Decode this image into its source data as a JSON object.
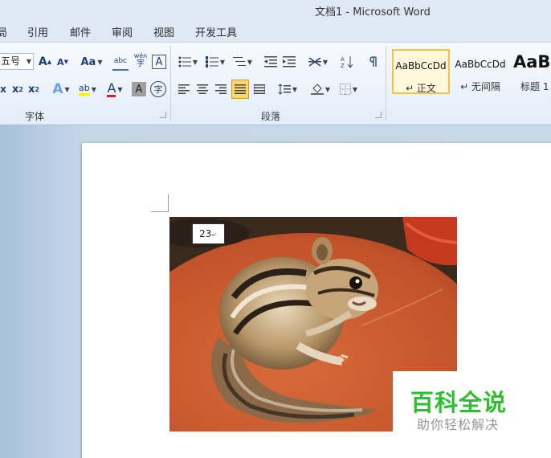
{
  "window": {
    "title": "文档1  -  Microsoft Word"
  },
  "tabs": [
    "局",
    "引用",
    "邮件",
    "审阅",
    "视图",
    "开发工具"
  ],
  "font_group": {
    "label": "字体",
    "font_size": "五号",
    "grow": "A",
    "shrink": "A",
    "change_case": "Aa",
    "phonetic": "abc",
    "phonetic_guide": "wén",
    "border_char": "A",
    "subscript": "x",
    "superscript": "x",
    "text_effect": "A",
    "highlight": "ab",
    "font_color": "A",
    "char_shading": "A",
    "enclose": "字",
    "strike": "x"
  },
  "paragraph_group": {
    "label": "段落"
  },
  "styles": [
    {
      "sample": "AaBbCcDd",
      "name": "↵ 正文"
    },
    {
      "sample": "AaBbCcDd",
      "name": "↵ 无间隔"
    },
    {
      "sample": "AaB",
      "name": "标题 1"
    }
  ],
  "document": {
    "textbox_text": "23",
    "textbox_mark": "↵"
  },
  "watermark": {
    "title": "百科全说",
    "subtitle": "助你轻松解决"
  },
  "colors": {
    "accent": "#2fbe2f",
    "font_red": "#d22222",
    "highlight_yellow": "#ffef00"
  }
}
